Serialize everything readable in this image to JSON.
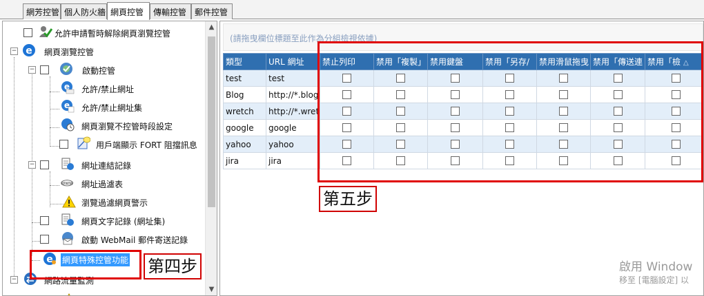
{
  "tabs": [
    {
      "label": "網芳控管"
    },
    {
      "label": "個人防火牆"
    },
    {
      "label": "網頁控管"
    },
    {
      "label": "傳輸控管"
    },
    {
      "label": "郵件控管"
    }
  ],
  "tree": {
    "items": [
      {
        "label": "允許申請暫時解除網頁瀏覽控管"
      },
      {
        "label": "網頁瀏覽控管"
      },
      {
        "label": "啟動控管"
      },
      {
        "label": "允許/禁止網址"
      },
      {
        "label": "允許/禁止網址集"
      },
      {
        "label": "網頁瀏覽不控管時段設定"
      },
      {
        "label": "用戶端顯示 FORT 阻擋訊息"
      },
      {
        "label": "網址連結記錄"
      },
      {
        "label": "網址過濾表"
      },
      {
        "label": "瀏覽過濾網頁警示"
      },
      {
        "label": "網頁文字記錄 (網址集)"
      },
      {
        "label": "啟動 WebMail 郵件寄送記錄"
      },
      {
        "label": "網頁特殊控管功能"
      },
      {
        "label": "網路流量監測"
      }
    ]
  },
  "group_hint": "(請拖曳欄位標題至此作為分組檢視依據)",
  "grid": {
    "columns": [
      "類型",
      "URL 網址",
      "禁止列印",
      "禁用「複製」",
      "禁用鍵盤",
      "禁用「另存/",
      "禁用滑鼠拖曳",
      "禁用「傳送連",
      "禁用「檢"
    ],
    "sort_indicator": "△",
    "rows": [
      {
        "type": "test",
        "url": "test",
        "checks": [
          false,
          false,
          false,
          false,
          false,
          false,
          false
        ]
      },
      {
        "type": "Blog",
        "url": "http://*.blog",
        "checks": [
          false,
          false,
          false,
          false,
          false,
          false,
          false
        ]
      },
      {
        "type": "wretch",
        "url": "http://*.wret",
        "checks": [
          false,
          false,
          false,
          false,
          false,
          false,
          false
        ]
      },
      {
        "type": "google",
        "url": "google",
        "checks": [
          false,
          false,
          false,
          false,
          false,
          false,
          false
        ]
      },
      {
        "type": "yahoo",
        "url": "yahoo",
        "checks": [
          false,
          false,
          false,
          false,
          false,
          false,
          false
        ]
      },
      {
        "type": "jira",
        "url": "jira",
        "checks": [
          false,
          false,
          false,
          false,
          false,
          false,
          false
        ]
      }
    ]
  },
  "annotations": {
    "step4": "第四步",
    "step5": "第五步",
    "color": "#e00000"
  },
  "watermark": {
    "line1": "啟用 Window",
    "line2": "移至 [電腦設定] 以"
  }
}
